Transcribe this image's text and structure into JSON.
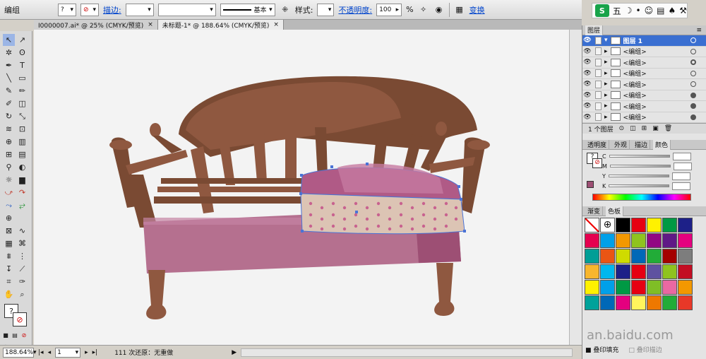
{
  "control_bar": {
    "selection": "编组",
    "stroke_label": "描边:",
    "stroke_style": "基本",
    "style_label": "样式:",
    "opacity_label": "不透明度:",
    "opacity_value": "100",
    "opacity_unit": "%",
    "transform_link": "变换"
  },
  "ime": {
    "mode": "五"
  },
  "tabs": [
    {
      "label": "I0000007.ai* @ 25% (CMYK/预览)",
      "close": "×"
    },
    {
      "label": "未标题-1* @ 188.64% (CMYK/预览)",
      "close": "×"
    }
  ],
  "status": {
    "zoom": "188.64%",
    "artboard": "1",
    "message": "111 次还原：无重做"
  },
  "layers_panel": {
    "title": "图层",
    "top_layer": "图层 1",
    "rows": [
      "<编组>",
      "<编组>",
      "<编组>",
      "<编组>",
      "<编组>",
      "<编组>",
      "<编组>"
    ],
    "footer": "1 个图层"
  },
  "color_panel": {
    "tabs": [
      "透明度",
      "外观",
      "描边",
      "颜色"
    ],
    "channels": [
      "C",
      "M",
      "Y",
      "K"
    ]
  },
  "swatch_panel": {
    "tabs": [
      "渐变",
      "色板"
    ],
    "colors": [
      "#ffffff",
      "#ffffff",
      "#000000",
      "#e60012",
      "#fff100",
      "#009944",
      "#1d2088",
      "#e5004f",
      "#00a0e9",
      "#f39800",
      "#8fc31f",
      "#920783",
      "#601986",
      "#e4007f",
      "#009e96",
      "#ea5514",
      "#cfdb00",
      "#0068b7",
      "#22ac38",
      "#a40000",
      "#7d7d7d",
      "#f8b62d",
      "#00b7ee",
      "#1d2088",
      "#e60012",
      "#5f52a0",
      "#8fc31f",
      "#c30d23",
      "#fff100",
      "#00a0e9",
      "#009944",
      "#e60012",
      "#7fbe26",
      "#ea68a2",
      "#f39800",
      "#00a29a",
      "#0068b7",
      "#e4007f",
      "#fff45c",
      "#ee7800",
      "#22ac38",
      "#e83828"
    ],
    "footer_checkbox": "叠印填充",
    "footer_checkbox2": "叠印描边"
  },
  "watermark": "an.baidu.com"
}
